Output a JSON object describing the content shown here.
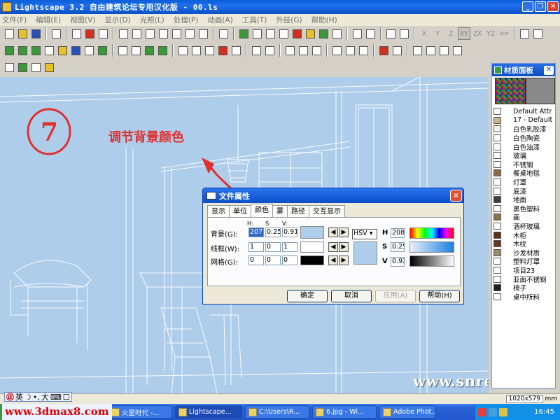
{
  "window": {
    "title": "Lightscape 3.2 自由建筑论坛专用汉化版  - 00.ls"
  },
  "menu": [
    "文件(F)",
    "编辑(E)",
    "视图(V)",
    "显示(D)",
    "光照(L)",
    "处理(P)",
    "动画(A)",
    "工具(T)",
    "外挂(G)",
    "帮助(H)"
  ],
  "toolbar1_letters": [
    "X",
    "Y",
    "Z",
    "XY",
    "ZX",
    "YZ",
    "Aim"
  ],
  "annotation": {
    "number": "7",
    "note": "调节背景颜色"
  },
  "dialog": {
    "title": "文件属性",
    "tabs": [
      "显示",
      "单位",
      "颜色",
      "雾",
      "路径",
      "交互显示"
    ],
    "active_tab": "颜色",
    "col_headers": [
      "H:",
      "S:",
      "V:"
    ],
    "rows": [
      {
        "label": "背景(G):",
        "h": "207",
        "s": "0.25",
        "v": "0.91",
        "color": "#aecdea"
      },
      {
        "label": "线框(W):",
        "h": "1",
        "s": "0",
        "v": "1",
        "color": "#ffffff"
      },
      {
        "label": "网格(G):",
        "h": "0",
        "s": "0",
        "v": "0",
        "color": "#000000"
      }
    ],
    "mode_select": "HSV",
    "h_label": "H",
    "s_label": "S",
    "v_label": "V",
    "h_value": "208.",
    "s_value": "0.25",
    "v_value": "0.92",
    "buttons": {
      "ok": "确定",
      "cancel": "取消",
      "apply": "应用(A)",
      "help": "帮助(H)"
    }
  },
  "material_panel": {
    "title": "材质面板",
    "items": [
      {
        "label": "Default Attr",
        "color": "#ffffff"
      },
      {
        "label": "17 - Default",
        "color": "#c8b890"
      },
      {
        "label": "白色乳胶漆",
        "color": "#f2f0e8"
      },
      {
        "label": "白色陶瓷",
        "color": "#ffffff"
      },
      {
        "label": "白色油漆",
        "color": "#ffffff"
      },
      {
        "label": "玻璃",
        "color": "#ffffff"
      },
      {
        "label": "不锈钢",
        "color": "#ffffff"
      },
      {
        "label": "餐桌地毯",
        "color": "#8a6a4a"
      },
      {
        "label": "灯罩",
        "color": "#ffffff"
      },
      {
        "label": "底漆",
        "color": "#ffffff"
      },
      {
        "label": "地面",
        "color": "#404040"
      },
      {
        "label": "黑色塑料",
        "color": "#ffffff"
      },
      {
        "label": "画",
        "color": "#8a7050"
      },
      {
        "label": "酒杯玻璃",
        "color": "#ffffff"
      },
      {
        "label": "木柜",
        "color": "#5a3018"
      },
      {
        "label": "木纹",
        "color": "#6a3820"
      },
      {
        "label": "沙发材质",
        "color": "#9a8a70"
      },
      {
        "label": "塑料灯罩",
        "color": "#ffffff"
      },
      {
        "label": "项目23",
        "color": "#ffffff"
      },
      {
        "label": "亚面不锈钢",
        "color": "#ffffff"
      },
      {
        "label": "椅子",
        "color": "#202020"
      },
      {
        "label": "桌中所料",
        "color": "#ffffff"
      }
    ]
  },
  "status": {
    "coords": "1020x579",
    "unit": "mm"
  },
  "ime": {
    "items": [
      "英",
      "☽",
      "•,",
      "大",
      "⌨",
      "☐"
    ]
  },
  "watermarks": {
    "left": "www.3dmax8.com",
    "right": "www.snren.com"
  },
  "taskbar": {
    "tasks": [
      "火星时代 -...",
      "Lightscape...",
      "C:\\Users\\R...",
      "6.jpg - Wi...",
      "Adobe Phot..."
    ],
    "clock": "16:45"
  },
  "colors": {
    "viewport_bg": "#aecdea",
    "annotation": "#e03030"
  }
}
